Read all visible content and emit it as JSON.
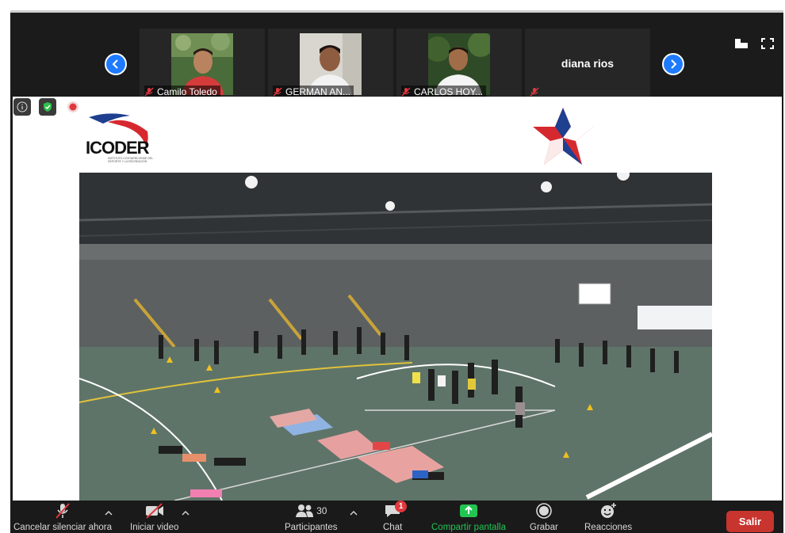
{
  "gallery": {
    "participants": [
      {
        "name": "Camilo Toledo"
      },
      {
        "name": "GERMAN AN..."
      },
      {
        "name": "CARLOS HOY..."
      },
      {
        "name": "diana rios"
      }
    ]
  },
  "share": {
    "logo_left_text": "ICODER",
    "logo_left_subtext": "INSTITUTO COSTARRICENSE DEL DEPORTE Y LA RECREACIÓN"
  },
  "toolbar": {
    "unmute_label": "Cancelar silenciar ahora",
    "start_video_label": "Iniciar video",
    "participants_label": "Participantes",
    "participants_count": "30",
    "chat_label": "Chat",
    "chat_badge": "1",
    "share_label": "Compartir pantalla",
    "record_label": "Grabar",
    "reactions_label": "Reacciones",
    "leave_label": "Salir"
  },
  "colors": {
    "accent_blue": "#1e7bff",
    "share_green": "#23c552",
    "leave_red": "#c8342e",
    "muted_red": "#e0383e"
  }
}
